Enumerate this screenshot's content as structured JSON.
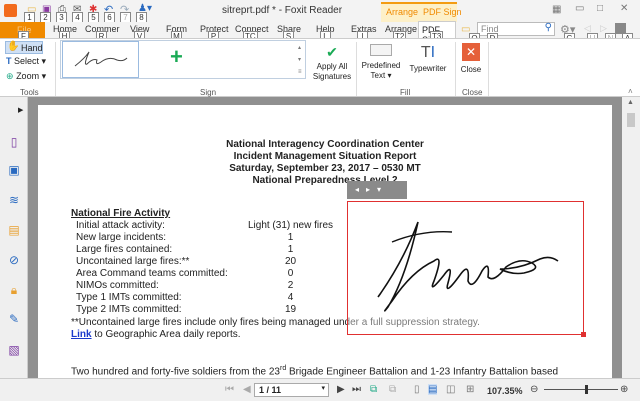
{
  "window": {
    "title": "sitreprt.pdf * - Foxit Reader",
    "context_group": "Arrange  PDF Sign"
  },
  "quick_access_keys": [
    "1",
    "2",
    "3",
    "4",
    "5",
    "6",
    "7",
    "8"
  ],
  "tabs": [
    {
      "label": "File",
      "key": "F"
    },
    {
      "label": "Home",
      "key": "H"
    },
    {
      "label": "Commer",
      "key": "R"
    },
    {
      "label": "View",
      "key": "V"
    },
    {
      "label": "Form",
      "key": "M"
    },
    {
      "label": "Protect",
      "key": "P"
    },
    {
      "label": "Connect",
      "key": "TC"
    },
    {
      "label": "Share",
      "key": "S"
    },
    {
      "label": "Help",
      "key": "L"
    },
    {
      "label": "Extras",
      "key": "I"
    },
    {
      "label": "Arrange",
      "key": "T2"
    },
    {
      "label": "PDF Sig",
      "key": "T3"
    }
  ],
  "search": {
    "placeholder": "Find",
    "keys": [
      "Q",
      "D",
      "G",
      "U",
      "N",
      "A"
    ]
  },
  "ribbon": {
    "tools": {
      "hand": "Hand",
      "select": "Select",
      "zoom": "Zoom",
      "group": "Tools"
    },
    "sign": {
      "group": "Sign",
      "apply_all": "Apply All Signatures"
    },
    "fill": {
      "predefined": "Predefined Text",
      "typewriter": "Typewriter",
      "group": "Fill"
    },
    "close": {
      "label": "Close",
      "group": "Close"
    }
  },
  "document": {
    "header": [
      "National Interagency Coordination Center",
      "Incident Management Situation Report",
      "Saturday, September 23, 2017 – 0530 MT",
      "National Preparedness Level 2"
    ],
    "section": "National Fire Activity",
    "rows": [
      {
        "label": "Initial attack activity:",
        "value": "Light (31) new fires"
      },
      {
        "label": "New large incidents:",
        "value": "1"
      },
      {
        "label": "Large fires contained:",
        "value": "1"
      },
      {
        "label": "Uncontained large fires:**",
        "value": "20"
      },
      {
        "label": "Area Command teams committed:",
        "value": "0"
      },
      {
        "label": "NIMOs committed:",
        "value": "2"
      },
      {
        "label": "Type 1 IMTs committed:",
        "value": "4"
      },
      {
        "label": "Type 2 IMTs committed:",
        "value": "19"
      }
    ],
    "footnote": "**Uncontained large fires include only fires being managed under a full suppression strategy.",
    "link": "Link",
    "link_rest": " to Geographic Area daily reports.",
    "para_a": "Two hundred and forty-five soldiers from the 23",
    "para_sup": "rd",
    "para_b": " Brigade Engineer Battalion and 1-23 Infantry Battalion based"
  },
  "status": {
    "page": "1 / 11",
    "zoom": "107.35%",
    "zoom_slider": 0.55
  },
  "colors": {
    "accent": "#f08a00",
    "signature_box": "#e03030",
    "add": "#1aaa55"
  }
}
